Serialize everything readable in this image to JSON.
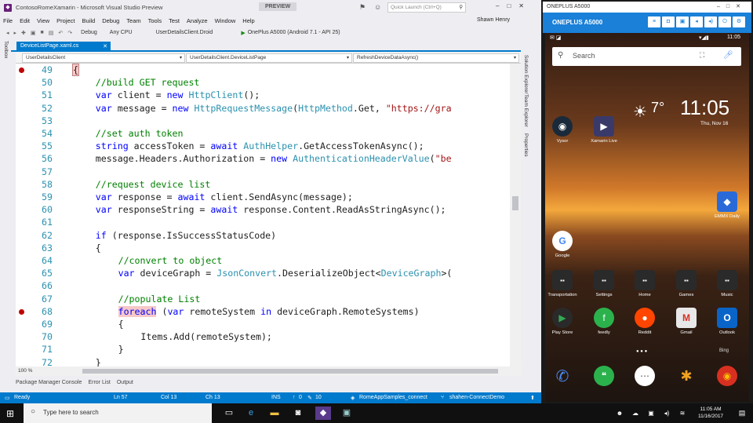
{
  "window": {
    "title": "ContosoRomeXamarin - Microsoft Visual Studio Preview",
    "preview_badge": "PREVIEW",
    "quick_launch_placeholder": "Quick Launch (Ctrl+Q)",
    "user": "Shawn Henry"
  },
  "menu": [
    "File",
    "Edit",
    "View",
    "Project",
    "Build",
    "Debug",
    "Team",
    "Tools",
    "Test",
    "Analyze",
    "Window",
    "Help"
  ],
  "toolbar": {
    "config": "Debug",
    "platform": "Any CPU",
    "startup": "UserDetailsClient.Droid",
    "device": "OnePlus A5000 (Android 7.1 - API 25)"
  },
  "side_tabs": {
    "left": "Toolbox",
    "right": [
      "Solution Explorer",
      "Team Explorer",
      "Properties"
    ]
  },
  "doc_tab": "DeviceListPage.xaml.cs",
  "nav": {
    "project": "UserDetailsClient",
    "class": "UserDetailsClient.DeviceListPage",
    "member": "RefreshDeviceDataAsync()"
  },
  "code": [
    {
      "n": "49",
      "t": [
        [
          "{",
          "d"
        ]
      ],
      "indent": 2,
      "brace_highlight": true,
      "bp": true
    },
    {
      "n": "50",
      "t": [
        [
          "//build GET request",
          "c"
        ]
      ],
      "indent": 3
    },
    {
      "n": "51",
      "t": [
        [
          "var",
          "k"
        ],
        [
          " client = ",
          "d"
        ],
        [
          "new",
          "k"
        ],
        [
          " ",
          "d"
        ],
        [
          "HttpClient",
          "t"
        ],
        [
          "();",
          "d"
        ]
      ],
      "indent": 3
    },
    {
      "n": "52",
      "t": [
        [
          "var",
          "k"
        ],
        [
          " message = ",
          "d"
        ],
        [
          "new",
          "k"
        ],
        [
          " ",
          "d"
        ],
        [
          "HttpRequestMessage",
          "t"
        ],
        [
          "(",
          "d"
        ],
        [
          "HttpMethod",
          "t"
        ],
        [
          ".Get, ",
          "d"
        ],
        [
          "\"https://gra",
          "s"
        ]
      ],
      "indent": 3
    },
    {
      "n": "53",
      "t": [],
      "indent": 3
    },
    {
      "n": "54",
      "t": [
        [
          "//set auth token",
          "c"
        ]
      ],
      "indent": 3
    },
    {
      "n": "55",
      "t": [
        [
          "string",
          "k"
        ],
        [
          " accessToken = ",
          "d"
        ],
        [
          "await",
          "k"
        ],
        [
          " ",
          "d"
        ],
        [
          "AuthHelper",
          "t"
        ],
        [
          ".GetAccessTokenAsync();",
          "d"
        ]
      ],
      "indent": 3
    },
    {
      "n": "56",
      "t": [
        [
          "message.Headers.Authorization = ",
          "d"
        ],
        [
          "new",
          "k"
        ],
        [
          " ",
          "d"
        ],
        [
          "AuthenticationHeaderValue",
          "t"
        ],
        [
          "(",
          "d"
        ],
        [
          "\"be",
          "s"
        ]
      ],
      "indent": 3
    },
    {
      "n": "57",
      "t": [],
      "indent": 3
    },
    {
      "n": "58",
      "t": [
        [
          "//request device list",
          "c"
        ]
      ],
      "indent": 3
    },
    {
      "n": "59",
      "t": [
        [
          "var",
          "k"
        ],
        [
          " response = ",
          "d"
        ],
        [
          "await",
          "k"
        ],
        [
          " client.SendAsync(message);",
          "d"
        ]
      ],
      "indent": 3
    },
    {
      "n": "60",
      "t": [
        [
          "var",
          "k"
        ],
        [
          " responseString = ",
          "d"
        ],
        [
          "await",
          "k"
        ],
        [
          " response.Content.ReadAsStringAsync();",
          "d"
        ]
      ],
      "indent": 3
    },
    {
      "n": "61",
      "t": [],
      "indent": 3
    },
    {
      "n": "62",
      "t": [
        [
          "if",
          "k"
        ],
        [
          " (response.IsSuccessStatusCode)",
          "d"
        ]
      ],
      "indent": 3
    },
    {
      "n": "63",
      "t": [
        [
          "{",
          "d"
        ]
      ],
      "indent": 3
    },
    {
      "n": "64",
      "t": [
        [
          "//convert to object",
          "c"
        ]
      ],
      "indent": 4
    },
    {
      "n": "65",
      "t": [
        [
          "var",
          "k"
        ],
        [
          " deviceGraph = ",
          "d"
        ],
        [
          "JsonConvert",
          "t"
        ],
        [
          ".DeserializeObject<",
          "d"
        ],
        [
          "DeviceGraph",
          "t"
        ],
        [
          ">(",
          "d"
        ]
      ],
      "indent": 4
    },
    {
      "n": "66",
      "t": [],
      "indent": 4
    },
    {
      "n": "67",
      "t": [
        [
          "//populate List",
          "c"
        ]
      ],
      "indent": 4
    },
    {
      "n": "68",
      "t": [
        [
          "foreach",
          "h"
        ],
        [
          " (",
          "d"
        ],
        [
          "var",
          "k"
        ],
        [
          " remoteSystem ",
          "d"
        ],
        [
          "in",
          "k"
        ],
        [
          " deviceGraph.RemoteSystems)",
          "d"
        ]
      ],
      "indent": 4,
      "bp": true
    },
    {
      "n": "69",
      "t": [
        [
          "{",
          "d"
        ]
      ],
      "indent": 4
    },
    {
      "n": "70",
      "t": [
        [
          "Items.Add(remoteSystem);",
          "d"
        ]
      ],
      "indent": 5
    },
    {
      "n": "71",
      "t": [
        [
          "}",
          "d"
        ]
      ],
      "indent": 4
    },
    {
      "n": "72",
      "t": [
        [
          "}",
          "d"
        ]
      ],
      "indent": 3
    }
  ],
  "zoom": "100 %",
  "bottom_tabs": [
    "Package Manager Console",
    "Error List",
    "Output"
  ],
  "status": {
    "ready": "Ready",
    "ln": "Ln 57",
    "col": "Col 13",
    "ch": "Ch 13",
    "ins": "INS",
    "up": "0",
    "pencil": "10",
    "repo": "RomeAppSamples_connect",
    "branch": "shahen-ConnectDemo"
  },
  "emulator": {
    "window_title": "ONEPLUS A5000",
    "bar_title": "ONEPLUS A5000",
    "time_status": "11:05",
    "search_label": "Search",
    "temperature": "7°",
    "clock": "11:05",
    "date": "Thu, Nov 16",
    "apps_top": [
      {
        "label": "Vysor",
        "icon": "vysor-icon",
        "color": "#1a2a3a"
      },
      {
        "label": "Xamarin Live",
        "icon": "play-icon",
        "color": "#3a3a6a"
      }
    ],
    "emmx": {
      "label": "EMMX Daily",
      "color": "#2a6ad8"
    },
    "google": {
      "label": "Google",
      "color": "#ffffff"
    },
    "folders": [
      {
        "label": "Transportation",
        "color": "#2a2a2a"
      },
      {
        "label": "Settings",
        "color": "#2a2a2a"
      },
      {
        "label": "Home",
        "color": "#2a2a2a"
      },
      {
        "label": "Games",
        "color": "#2a2a2a"
      },
      {
        "label": "Music",
        "color": "#2a2a2a"
      }
    ],
    "apps_row": [
      {
        "label": "Play Store",
        "glyph": "▶",
        "color": "#2a2a2a"
      },
      {
        "label": "feedly",
        "glyph": "f",
        "color": "#2bb24c"
      },
      {
        "label": "Reddit",
        "glyph": "●",
        "color": "#ff4500"
      },
      {
        "label": "Gmail",
        "glyph": "M",
        "color": "#e8e8e8"
      },
      {
        "label": "Outlook",
        "glyph": "O",
        "color": "#0a64c8"
      }
    ],
    "dock": [
      {
        "name": "phone-icon",
        "glyph": "✆",
        "color": "#1a60c8"
      },
      {
        "name": "hangouts-icon",
        "glyph": "❝",
        "color": "#2bb24c"
      },
      {
        "name": "apps-drawer-icon",
        "glyph": "⋯",
        "color": "#ffffff"
      },
      {
        "name": "photos-icon",
        "glyph": "✱",
        "color": "#f0a020"
      },
      {
        "name": "chrome-icon",
        "glyph": "◉",
        "color": "#d83020"
      }
    ],
    "bing": "Bing"
  },
  "taskbar": {
    "search_placeholder": "Type here to search",
    "time": "11:05 AM",
    "date": "11/16/2017"
  }
}
